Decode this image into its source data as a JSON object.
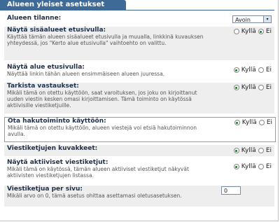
{
  "header": {
    "title": "Alueen yleiset asetukset"
  },
  "status_row": {
    "label": "Alueen tilanne:",
    "select_value": "Avoin",
    "arrow": "▾"
  },
  "rows": [
    {
      "label": "Näytä sisäalueet etusivulla:",
      "desc": "Käyttää tämän alueen sisäalueet etusivulla ja muualla, linkkinä kuvauksen yhteydessä, jos \"Kerto alue etusivulla\" vaihtoehto on valittu.",
      "yes": "Kyllä",
      "no": "Ei",
      "selected": "no"
    },
    {
      "label": "Näytä alue etusivulla:",
      "desc": "Näyttää linkin tähän alueen ensimmäiseen alueen juuressa.",
      "yes": "Kyllä",
      "no": "Ei",
      "selected": "yes"
    },
    {
      "label": "Tarkista vastaukset:",
      "desc": "Mikäli tämä on otettu käyttöön, saat varoituksen, jos joku on kirjoittanut uuden viestin kesken omasi kirjoittamisen. Tämä toiminto on käytössä aktiivisille viestiketjuille.",
      "yes": "Kyllä",
      "no": "Ei",
      "selected": "yes"
    },
    {
      "label": "Ota hakutoiminto käyttöön:",
      "desc": "Mikäli tämä on otettu käyttöön, alueen viestejä voi etsiä hakutoiminnon avulla.",
      "yes": "Kyllä",
      "no": "Ei",
      "selected": "yes"
    },
    {
      "label": "Viestiketjujen kuvakkeet:",
      "desc": "",
      "yes": "Kyllä",
      "no": "Ei",
      "selected": "yes"
    },
    {
      "label": "Näytä aktiiviset viestiketjut:",
      "desc": "Mikäli tämä on käytössä, tämän alueen aktiiviset viestiketjut näkyvät aktiivisten viestiketjujen listassa.",
      "yes": "Kyllä",
      "no": "Ei",
      "selected": "yes"
    }
  ],
  "per_page": {
    "label": "Viestiketjua per sivu:",
    "desc": "Mikäli arvo on 0, tämä asetus ohittaa asettamasi oletusasetuksen.",
    "value": "0"
  },
  "colors": {
    "header": "#3d6a96",
    "shade": "#eeeeee",
    "radio_on": "#1a7a1a"
  }
}
